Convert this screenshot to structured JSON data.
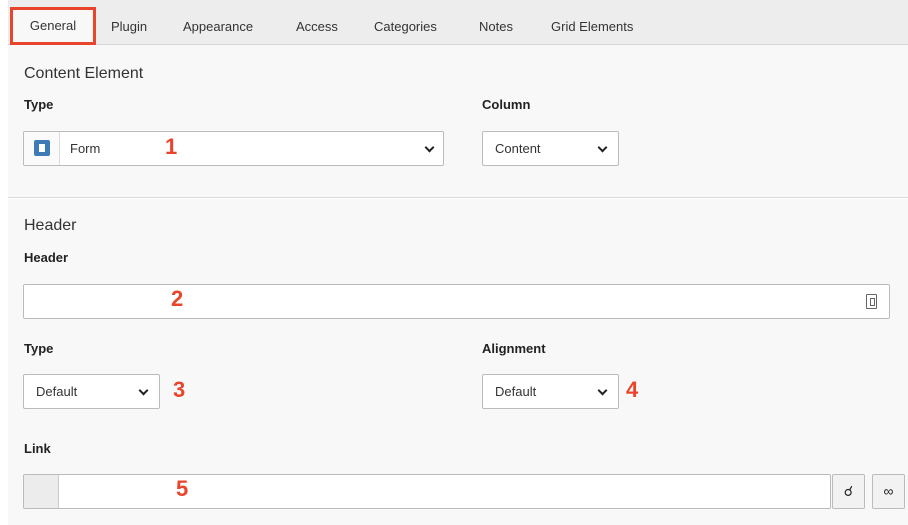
{
  "tabs": [
    {
      "label": "General",
      "active": true
    },
    {
      "label": "Plugin"
    },
    {
      "label": "Appearance"
    },
    {
      "label": "Access"
    },
    {
      "label": "Categories"
    },
    {
      "label": "Notes"
    },
    {
      "label": "Grid Elements"
    }
  ],
  "content_element": {
    "title": "Content Element",
    "type_label": "Type",
    "type_value": "Form",
    "type_icon": "form-icon",
    "column_label": "Column",
    "column_value": "Content"
  },
  "header_section": {
    "title": "Header",
    "header_label": "Header",
    "header_value": "",
    "type_label": "Type",
    "type_value": "Default",
    "alignment_label": "Alignment",
    "alignment_value": "Default",
    "link_label": "Link",
    "link_value": ""
  },
  "annotations": [
    "1",
    "2",
    "3",
    "4",
    "5"
  ],
  "colors": {
    "annotation": "#e8452c",
    "active_tab_border": "#e8452c",
    "type_icon": "#3e7bb6"
  }
}
